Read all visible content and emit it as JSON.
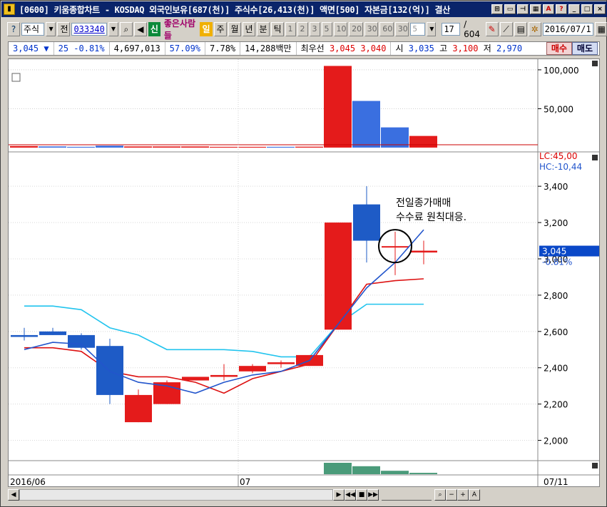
{
  "window": {
    "title": "[0600] 키움종합차트 - KOSDAQ 외국인보유[687(천)] 주식수[26,413(천)] 액면[500] 자본금[132(억)] 결산",
    "app_icon": "chart-app-icon"
  },
  "toolbar": {
    "market_select": "주식",
    "prev_label": "전",
    "code_value": "033340",
    "company_name": "좋은사람들",
    "period_tabs": [
      "일",
      "주",
      "월",
      "년",
      "분",
      "틱"
    ],
    "minute_options": [
      "1",
      "2",
      "3",
      "5",
      "10",
      "20",
      "30",
      "60",
      "30",
      "5"
    ],
    "count_value": "17",
    "count_total": "/ 604",
    "date_value": "2016/07/1"
  },
  "quote": {
    "price": "3,045",
    "change_arrow": "▼",
    "change": "25",
    "change_pct": "-0.81%",
    "volume": "4,697,013",
    "ratio1": "57.09%",
    "ratio2": "7.78%",
    "amount": "14,288백만",
    "best_label": "최우선",
    "ask": "3,045",
    "bid": "3,040",
    "open_label": "시",
    "open": "3,035",
    "high_label": "고",
    "high": "3,100",
    "low_label": "저",
    "low": "2,970",
    "buy_label": "매수",
    "sell_label": "매도"
  },
  "chart": {
    "lc_label": "LC:45,00",
    "hc_label": "HC:-10,44",
    "annotation_line1": "전일종가매매",
    "annotation_line2": "수수료 원칙대응.",
    "current_price_tag": "3,045",
    "current_pct_tag": "-0.81%",
    "x_labels": [
      "2016/06",
      "07",
      "07/11"
    ],
    "colors": {
      "up": "#e41b1b",
      "down": "#1e5bc6",
      "ma_blue": "#2255cc",
      "ma_red": "#dd1111",
      "ma_cyan": "#22c4ee",
      "vol_green": "#4a9b7a"
    }
  },
  "chart_data": [
    {
      "type": "bar",
      "title": "",
      "yticks": [
        "100,000",
        "50,000"
      ],
      "ylim": [
        0,
        110000
      ],
      "values": [
        2000,
        1500,
        1000,
        2500,
        1500,
        1500,
        1500,
        1000,
        1000,
        1000,
        1200,
        105000,
        60000,
        26000,
        15000
      ],
      "directions": [
        "up",
        "down",
        "down",
        "down",
        "up",
        "up",
        "up",
        "up",
        "up",
        "down",
        "up",
        "up",
        "down",
        "down",
        "up"
      ]
    },
    {
      "type": "candlestick",
      "title": "",
      "yticks": [
        "3,400",
        "3,200",
        "3,000",
        "2,800",
        "2,600",
        "2,400",
        "2,200",
        "2,000"
      ],
      "ylim": [
        1900,
        3550
      ],
      "candles": [
        {
          "o": 2580,
          "h": 2620,
          "l": 2550,
          "c": 2570
        },
        {
          "o": 2600,
          "h": 2620,
          "l": 2580,
          "c": 2580
        },
        {
          "o": 2580,
          "h": 2590,
          "l": 2500,
          "c": 2510
        },
        {
          "o": 2520,
          "h": 2560,
          "l": 2200,
          "c": 2250
        },
        {
          "o": 2100,
          "h": 2280,
          "l": 2100,
          "c": 2250
        },
        {
          "o": 2200,
          "h": 2330,
          "l": 2200,
          "c": 2320
        },
        {
          "o": 2330,
          "h": 2350,
          "l": 2330,
          "c": 2350
        },
        {
          "o": 2350,
          "h": 2420,
          "l": 2330,
          "c": 2360
        },
        {
          "o": 2380,
          "h": 2420,
          "l": 2370,
          "c": 2410
        },
        {
          "o": 2420,
          "h": 2440,
          "l": 2400,
          "c": 2430
        },
        {
          "o": 2410,
          "h": 2470,
          "l": 2410,
          "c": 2470
        },
        {
          "o": 2610,
          "h": 3200,
          "l": 2610,
          "c": 3200
        },
        {
          "o": 3300,
          "h": 3400,
          "l": 2980,
          "c": 3100
        },
        {
          "o": 3070,
          "h": 3150,
          "l": 2910,
          "c": 3070
        },
        {
          "o": 3035,
          "h": 3100,
          "l": 2970,
          "c": 3045
        }
      ],
      "ma_blue": [
        2500,
        2540,
        2530,
        2380,
        2320,
        2300,
        2260,
        2320,
        2360,
        2380,
        2440,
        2640,
        2840,
        2980,
        3160
      ],
      "ma_red": [
        2510,
        2510,
        2490,
        2380,
        2350,
        2350,
        2320,
        2260,
        2340,
        2380,
        2420,
        2640,
        2860,
        2880,
        2890
      ],
      "ma_cyan": [
        2740,
        2740,
        2720,
        2620,
        2580,
        2500,
        2500,
        2500,
        2490,
        2460,
        2460,
        2640,
        2750,
        2750,
        2750
      ],
      "volume_strip": [
        0,
        0,
        0,
        0,
        0,
        0,
        0,
        0,
        0,
        0,
        0,
        100,
        70,
        30,
        12
      ]
    }
  ],
  "statusbar": {
    "icons": [
      "scroll-left-icon",
      "scroll-right-icon",
      "prev-page-icon",
      "stop-icon",
      "next-page-icon",
      "zoom-out-icon",
      "minus-icon",
      "plus-icon",
      "text-icon"
    ]
  }
}
